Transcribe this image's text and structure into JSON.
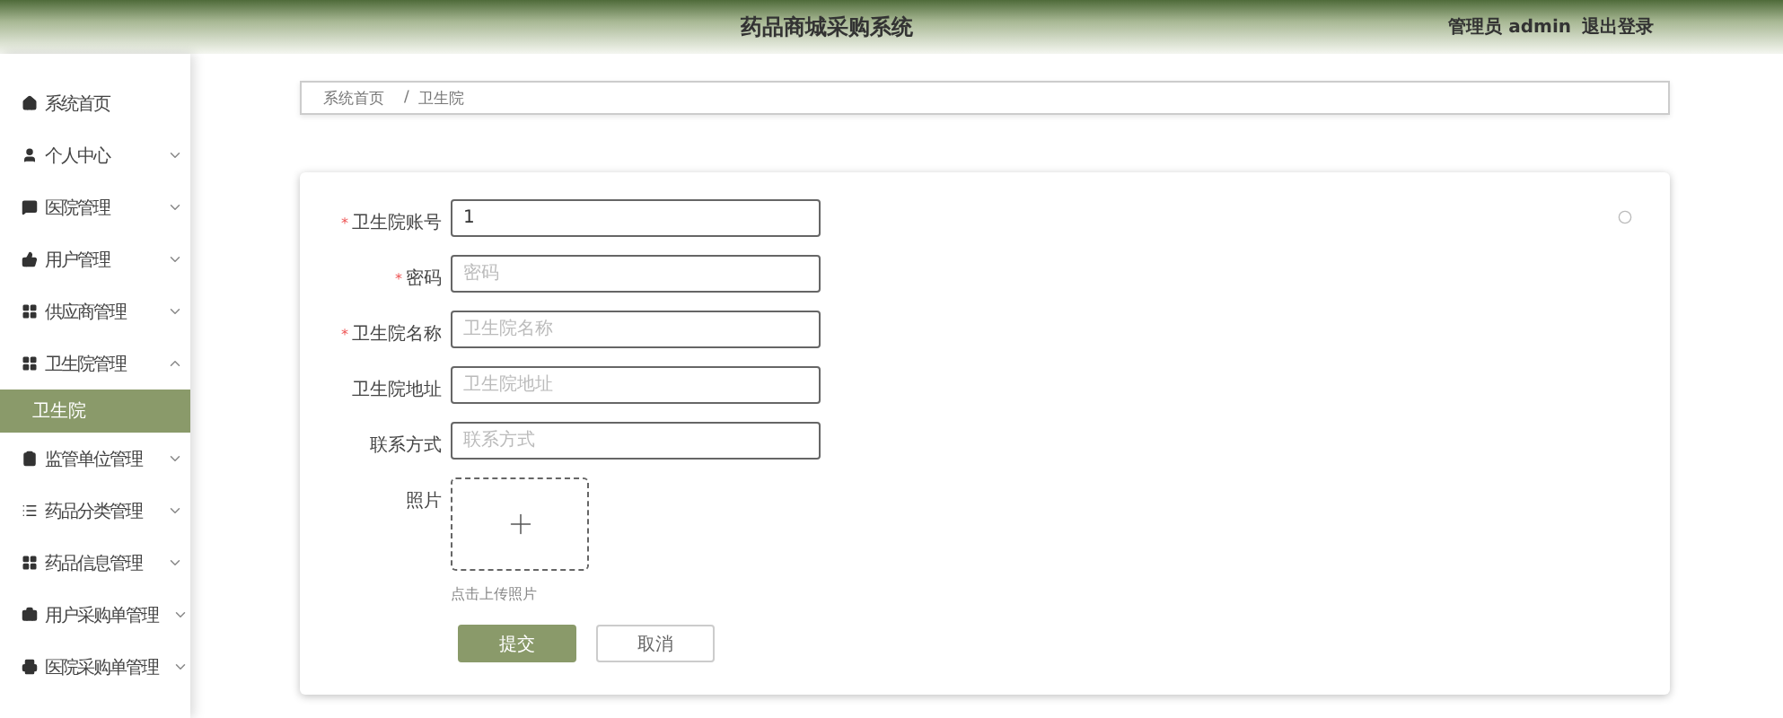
{
  "header": {
    "title": "药品商城采购系统",
    "user": "管理员 admin",
    "logout": "退出登录"
  },
  "sidebar": {
    "items": [
      {
        "label": "系统首页",
        "kind": "link"
      },
      {
        "label": "个人中心",
        "kind": "group",
        "expanded": false
      },
      {
        "label": "医院管理",
        "kind": "group",
        "expanded": false
      },
      {
        "label": "用户管理",
        "kind": "group",
        "expanded": false
      },
      {
        "label": "供应商管理",
        "kind": "group",
        "expanded": false
      },
      {
        "label": "卫生院管理",
        "kind": "group",
        "expanded": true,
        "children": [
          {
            "label": "卫生院",
            "selected": true
          }
        ]
      },
      {
        "label": "监管单位管理",
        "kind": "group",
        "expanded": false
      },
      {
        "label": "药品分类管理",
        "kind": "group",
        "expanded": false
      },
      {
        "label": "药品信息管理",
        "kind": "group",
        "expanded": false
      },
      {
        "label": "用户采购单管理",
        "kind": "group",
        "expanded": false
      },
      {
        "label": "医院采购单管理",
        "kind": "group",
        "expanded": false
      }
    ]
  },
  "breadcrumb": [
    "系统首页",
    "卫生院"
  ],
  "breadcrumb_separator": "/",
  "form": {
    "required_mark": "*",
    "fields": [
      {
        "kind": "text",
        "label": "卫生院账号",
        "required": true,
        "value": "1"
      },
      {
        "kind": "text",
        "label": "密码",
        "required": true,
        "placeholder": "密码"
      },
      {
        "kind": "text",
        "label": "卫生院名称",
        "required": true,
        "placeholder": "卫生院名称"
      },
      {
        "kind": "text",
        "label": "卫生院地址",
        "required": false,
        "placeholder": "卫生院地址"
      },
      {
        "kind": "text",
        "label": "联系方式",
        "required": false,
        "placeholder": "联系方式"
      },
      {
        "kind": "upload",
        "label": "照片",
        "required": false,
        "hint": "点击上传照片"
      }
    ],
    "buttons": [
      {
        "label": "提交",
        "primary": true
      },
      {
        "label": "取消",
        "primary": false
      }
    ]
  }
}
